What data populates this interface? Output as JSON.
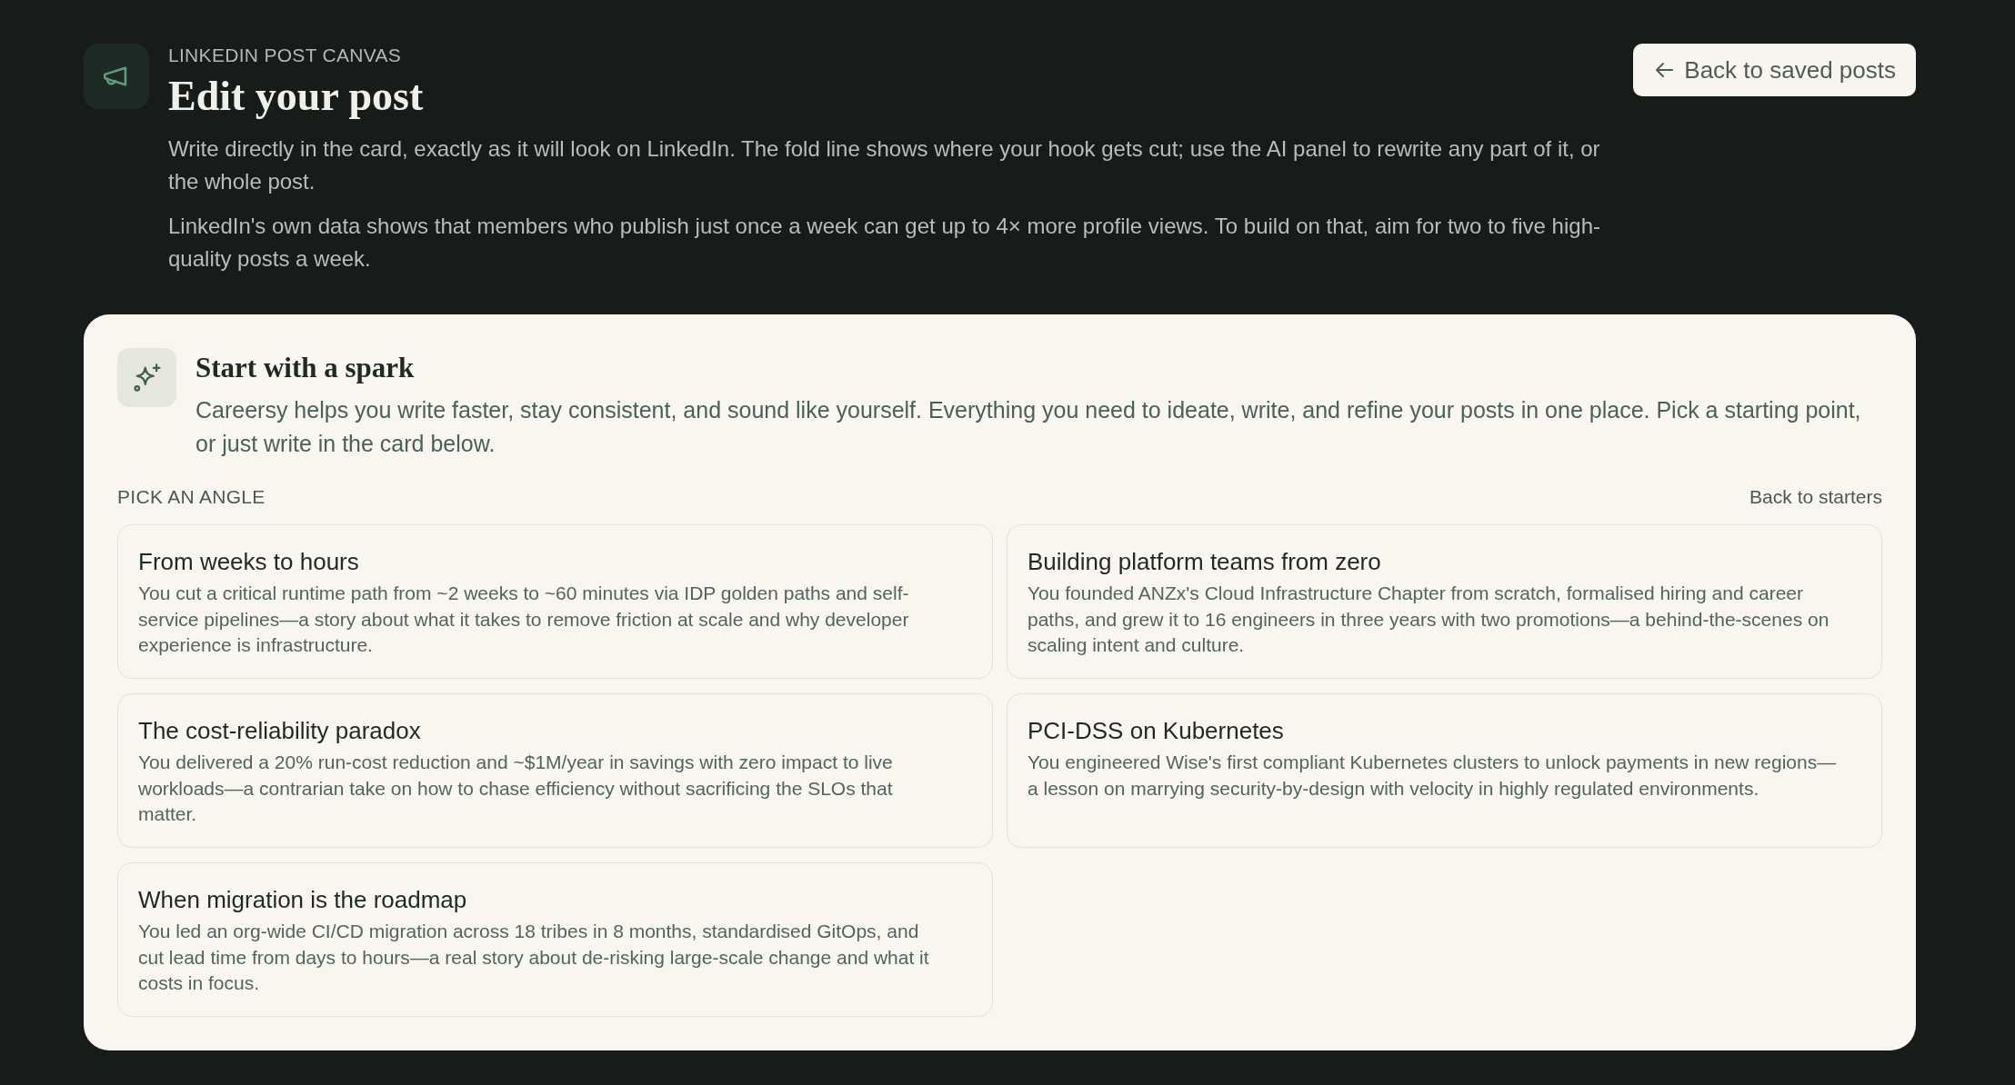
{
  "header": {
    "eyebrow": "LINKEDIN POST CANVAS",
    "title": "Edit your post",
    "paragraphs": [
      "Write directly in the card, exactly as it will look on LinkedIn. The fold line shows where your hook gets cut; use the AI panel to rewrite any part of it, or the whole post.",
      "LinkedIn's own data shows that members who publish just once a week can get up to 4× more profile views. To build on that, aim for two to five high-quality posts a week."
    ],
    "back_button": {
      "label": "Back to saved posts"
    }
  },
  "spark_panel": {
    "title": "Start with a spark",
    "description": "Careersy helps you write faster, stay consistent, and sound like yourself. Everything you need to ideate, write, and refine your posts in one place. Pick a starting point, or just write in the card below.",
    "section_label": "PICK AN ANGLE",
    "back_link": "Back to starters",
    "angles": [
      {
        "title": "From weeks to hours",
        "description": "You cut a critical runtime path from ~2 weeks to ~60 minutes via IDP golden paths and self-service pipelines—a story about what it takes to remove friction at scale and why developer experience is infrastructure."
      },
      {
        "title": "Building platform teams from zero",
        "description": "You founded ANZx's Cloud Infrastructure Chapter from scratch, formalised hiring and career paths, and grew it to 16 engineers in three years with two promotions—a behind-the-scenes on scaling intent and culture."
      },
      {
        "title": "The cost-reliability paradox",
        "description": "You delivered a 20% run-cost reduction and ~$1M/year in savings with zero impact to live workloads—a contrarian take on how to chase efficiency without sacrificing the SLOs that matter."
      },
      {
        "title": "PCI-DSS on Kubernetes",
        "description": "You engineered Wise's first compliant Kubernetes clusters to unlock payments in new regions—a lesson on marrying security-by-design with velocity in highly regulated environments."
      },
      {
        "title": "When migration is the roadmap",
        "description": "You led an org-wide CI/CD migration across 18 tribes in 8 months, standardised GitOps, and cut lead time from days to hours—a real story about de-risking large-scale change and what it costs in focus."
      }
    ]
  }
}
